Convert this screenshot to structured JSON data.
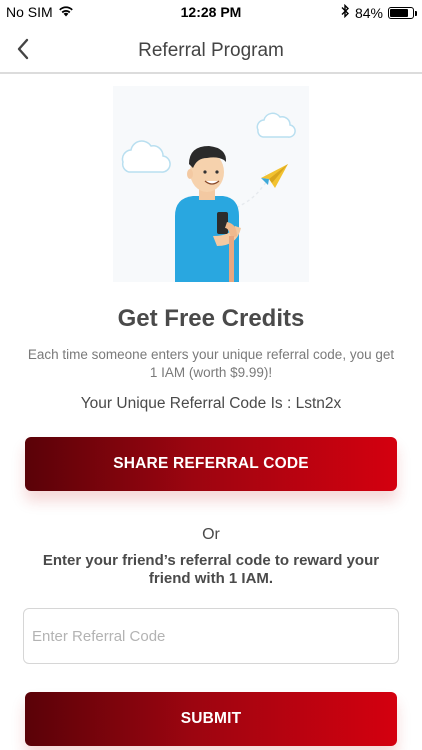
{
  "status_bar": {
    "carrier": "No SIM",
    "time": "12:28 PM",
    "battery": "84%",
    "battery_level": 0.84
  },
  "nav": {
    "title": "Referral Program"
  },
  "main": {
    "headline": "Get Free Credits",
    "description": "Each time someone enters your unique referral code, you get 1 IAM (worth $9.99)!",
    "code_line": "Your Unique Referral Code Is : Lstn2x",
    "share_button": "SHARE REFERRAL CODE",
    "or_text": "Or",
    "friend_text": "Enter your friend’s referral code to reward your friend with 1 IAM.",
    "input_placeholder": "Enter Referral Code",
    "submit_button": "SUBMIT"
  },
  "colors": {
    "button_dark": "#5a0208",
    "button_light": "#d4000f",
    "shirt": "#29a7e0",
    "plane": "#f2c230"
  }
}
